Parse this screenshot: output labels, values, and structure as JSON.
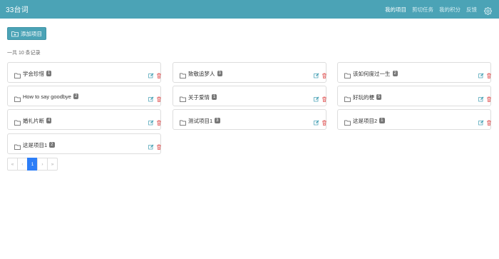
{
  "app": {
    "title": "33台词"
  },
  "nav": {
    "links": [
      "我的项目",
      "剪切任务",
      "我的积分",
      "反馈"
    ],
    "settings_icon": "gear-icon"
  },
  "toolbar": {
    "add_label": "添加项目"
  },
  "summary": {
    "count_text": "一共 10 条记录"
  },
  "projects": [
    {
      "name": "学会珍惜",
      "count": "1"
    },
    {
      "name": "致敬追梦人",
      "count": "3"
    },
    {
      "name": "该如何度过一生",
      "count": "2"
    },
    {
      "name": "How to say goodbye",
      "count": "2"
    },
    {
      "name": "关于爱情",
      "count": "1"
    },
    {
      "name": "好玩的梗",
      "count": "5"
    },
    {
      "name": "婚礼片断",
      "count": "4"
    },
    {
      "name": "测试项目1",
      "count": "3"
    },
    {
      "name": "这是项目2",
      "count": "1"
    },
    {
      "name": "这是项目1",
      "count": "2"
    }
  ],
  "pagination": {
    "first": "«",
    "prev": "‹",
    "current": "1",
    "next": "›",
    "last": "»"
  },
  "colors": {
    "primary": "#4ba3b6",
    "page_active": "#2d7ef7",
    "delete": "#e05252",
    "edit": "#4ba3b6"
  }
}
